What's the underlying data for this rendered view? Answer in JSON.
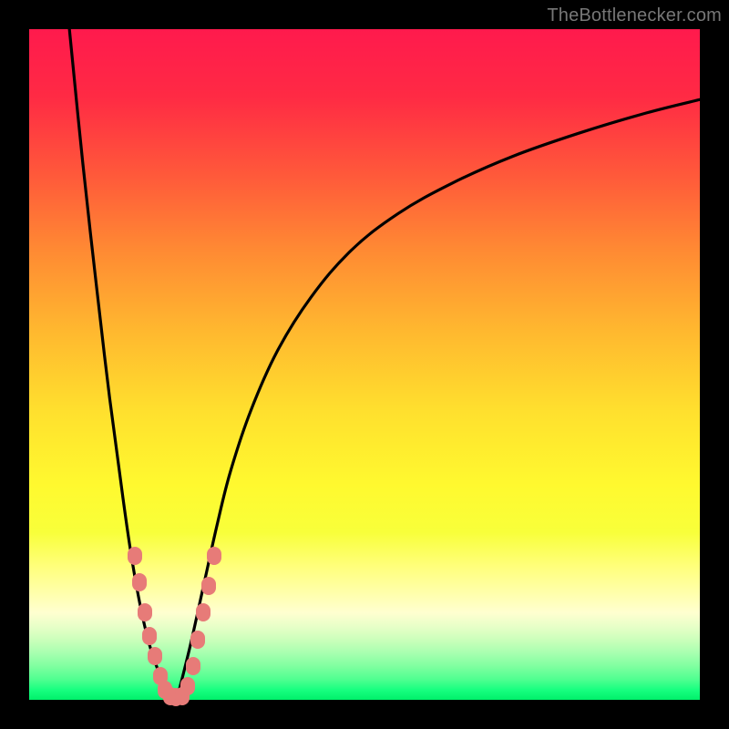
{
  "attribution": "TheBottlenecker.com",
  "colors": {
    "frame": "#000000",
    "curve": "#000000",
    "dot": "#e77b78"
  },
  "chart_data": {
    "type": "line",
    "title": "",
    "xlabel": "",
    "ylabel": "",
    "xlim": [
      0,
      100
    ],
    "ylim": [
      0,
      100
    ],
    "series": [
      {
        "name": "left-branch",
        "x": [
          6,
          8,
          10,
          12,
          14,
          15,
          16,
          17,
          18,
          19,
          20,
          21
        ],
        "y": [
          100,
          80,
          62,
          45,
          30,
          23,
          17,
          12,
          8,
          5,
          2.5,
          0
        ]
      },
      {
        "name": "right-branch",
        "x": [
          22,
          24,
          26,
          28,
          30,
          33,
          37,
          42,
          48,
          55,
          63,
          72,
          82,
          92,
          100
        ],
        "y": [
          0,
          8,
          17,
          26,
          34,
          43,
          52,
          60,
          67,
          72.5,
          77,
          81,
          84.5,
          87.5,
          89.5
        ]
      }
    ],
    "cluster_points": {
      "name": "salmon-dots",
      "color": "#e77b78",
      "points": [
        {
          "x": 15.7,
          "y": 21.5
        },
        {
          "x": 16.5,
          "y": 17.5
        },
        {
          "x": 17.3,
          "y": 13.0
        },
        {
          "x": 18.0,
          "y": 9.5
        },
        {
          "x": 18.7,
          "y": 6.5
        },
        {
          "x": 19.5,
          "y": 3.5
        },
        {
          "x": 20.3,
          "y": 1.5
        },
        {
          "x": 21.0,
          "y": 0.5
        },
        {
          "x": 21.9,
          "y": 0.4
        },
        {
          "x": 22.8,
          "y": 0.5
        },
        {
          "x": 23.6,
          "y": 2.0
        },
        {
          "x": 24.4,
          "y": 5.0
        },
        {
          "x": 25.2,
          "y": 9.0
        },
        {
          "x": 26.0,
          "y": 13.0
        },
        {
          "x": 26.8,
          "y": 17.0
        },
        {
          "x": 27.6,
          "y": 21.5
        }
      ]
    }
  }
}
